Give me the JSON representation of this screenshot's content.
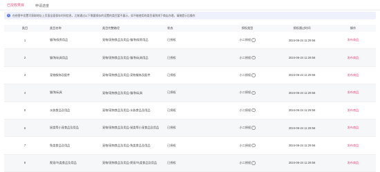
{
  "tabs": [
    {
      "label": "已授权类目"
    },
    {
      "label": "申请进度"
    }
  ],
  "notice": {
    "icon": "info-icon",
    "text": "在经营中设置可获取地址上页面全面保存时间信息，之前通过以下需要保存的设置的类目暂不展示，如不能使用的类目请到线下商店办理，请按提示后操作"
  },
  "table": {
    "headers": [
      "类目",
      "类目名称",
      "类目完整路径",
      "状态",
      "授权类型",
      "授权通过时间",
      "操作"
    ],
    "rows": [
      {
        "id": "1",
        "name": "猫/狗保养用品",
        "path": "宠物/宠物食品及用品-猫/狗保养用品",
        "status": "已授权",
        "type": "小二授权",
        "time": "2024-06-24 11:29:56",
        "action": "发布商品"
      },
      {
        "id": "2",
        "name": "猫/狗玩具用品",
        "path": "宠物/宠物食品及用品-猫/狗玩具用品",
        "status": "已授权",
        "type": "小二授权",
        "time": "2024-06-24 11:29:56",
        "action": "发布商品"
      },
      {
        "id": "3",
        "name": "宠物服饰及配件",
        "path": "宠物/宠物食品及用品-宠物服饰及配件",
        "status": "已授权",
        "type": "小二授权",
        "time": "2024-06-24 11:29:56",
        "action": "发布商品"
      },
      {
        "id": "4",
        "name": "猫/狗玩具",
        "path": "宠物/宠物食品及用品-猫/狗玩具",
        "status": "已授权",
        "type": "小二授权",
        "time": "2024-06-24 11:29:56",
        "action": "发布商品"
      },
      {
        "id": "5",
        "name": "水族食品及用品",
        "path": "宠物/宠物食品及用品-水族食品及用品",
        "status": "已授权",
        "type": "小二授权",
        "time": "2024-06-24 11:29:56",
        "action": "发布商品"
      },
      {
        "id": "6",
        "name": "鼠类等小宠食品及用品",
        "path": "宠物/宠物食品及用品-鼠类等小宠食品及用品",
        "status": "已授权",
        "type": "小二授权",
        "time": "2024-06-24 11:29:56",
        "action": "发布商品"
      },
      {
        "id": "7",
        "name": "兔类食品及用品",
        "path": "宠物/宠物食品及用品-兔类食品及用品",
        "status": "已授权",
        "type": "小二授权",
        "time": "2024-06-24 11:29:56",
        "action": "发布商品"
      },
      {
        "id": "8",
        "name": "爬宠/鸟类食品及用品",
        "path": "宠物/宠物食品及用品-爬宠/鸟类食品及用品",
        "status": "已授权",
        "type": "小二授权",
        "time": "2024-06-24 11:29:56",
        "action": "发布商品"
      }
    ]
  },
  "colors": {
    "accent": "#e5487a",
    "info": "#5b7be6",
    "notice_bg": "#eef1fb"
  }
}
